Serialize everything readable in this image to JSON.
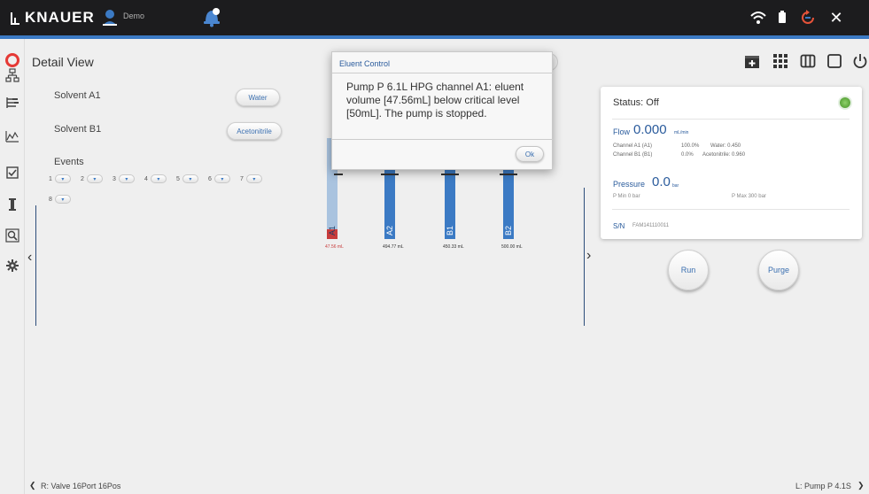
{
  "topbar": {
    "brand": "KNAUER",
    "user": "Demo",
    "icons": [
      "wifi-icon",
      "battery-icon",
      "rotate-icon",
      "close-icon"
    ],
    "close_glyph": "✕"
  },
  "header": {
    "title": "Detail View",
    "icons": [
      "add-window-icon",
      "grid-icon",
      "columns-icon",
      "window-icon",
      "power-icon"
    ]
  },
  "sidebar": {
    "items": [
      "network-icon",
      "hierarchy-icon",
      "chart-icon",
      "checkbox-icon",
      "instrument-icon",
      "zoom-icon",
      "settings-icon"
    ]
  },
  "left_panel": {
    "solvent_a1_label": "Solvent A1",
    "solvent_a1_value": "Water",
    "solvent_b1_label": "Solvent B1",
    "solvent_b1_value": "Acetonitrile",
    "events_label": "Events",
    "events": [
      "1",
      "2",
      "3",
      "4",
      "5",
      "6",
      "7",
      "8"
    ],
    "toggle_glyph": "▾"
  },
  "bottles": [
    {
      "name": "A1",
      "volume": "47.56 mL",
      "fill": 0.095,
      "low": true
    },
    {
      "name": "A2",
      "volume": "494.77 mL",
      "fill": 0.99,
      "low": false
    },
    {
      "name": "B1",
      "volume": "450.33 mL",
      "fill": 0.9,
      "low": false
    },
    {
      "name": "B2",
      "volume": "500.00 mL",
      "fill": 1.0,
      "low": false
    }
  ],
  "status_card": {
    "status": "Status: Off",
    "flow_label": "Flow",
    "flow_value": "0.000",
    "flow_unit": "mL/min",
    "channel_a": "Channel A1 (A1)",
    "channel_a_pct": "100.0%",
    "channel_a_solvent": "Water: 0.450",
    "channel_b": "Channel B1 (B1)",
    "channel_b_pct": "0.0%",
    "channel_b_solvent": "Acetonitrile: 0.960",
    "pressure_label": "Pressure",
    "pressure_value": "0.0",
    "pressure_unit": "bar",
    "pmin": "P Min  0 bar",
    "pmax": "P Max  300 bar",
    "sn_label": "S/N",
    "sn_value": "FAM141110011"
  },
  "buttons": {
    "run": "Run",
    "purge": "Purge"
  },
  "footer": {
    "left": "R: Valve 16Port 16Pos",
    "right": "L: Pump P 4.1S",
    "left_arrow": "❮",
    "right_arrow": "❯"
  },
  "dialog": {
    "title": "Eluent Control",
    "message": "Pump P 6.1L HPG channel A1: eluent volume [47.56mL] below critical level [50mL]. The pump is stopped.",
    "ok": "Ok"
  },
  "colors": {
    "accent": "#3b7ac4",
    "warning": "#c83c3c",
    "status_led": "#6bbf45"
  }
}
